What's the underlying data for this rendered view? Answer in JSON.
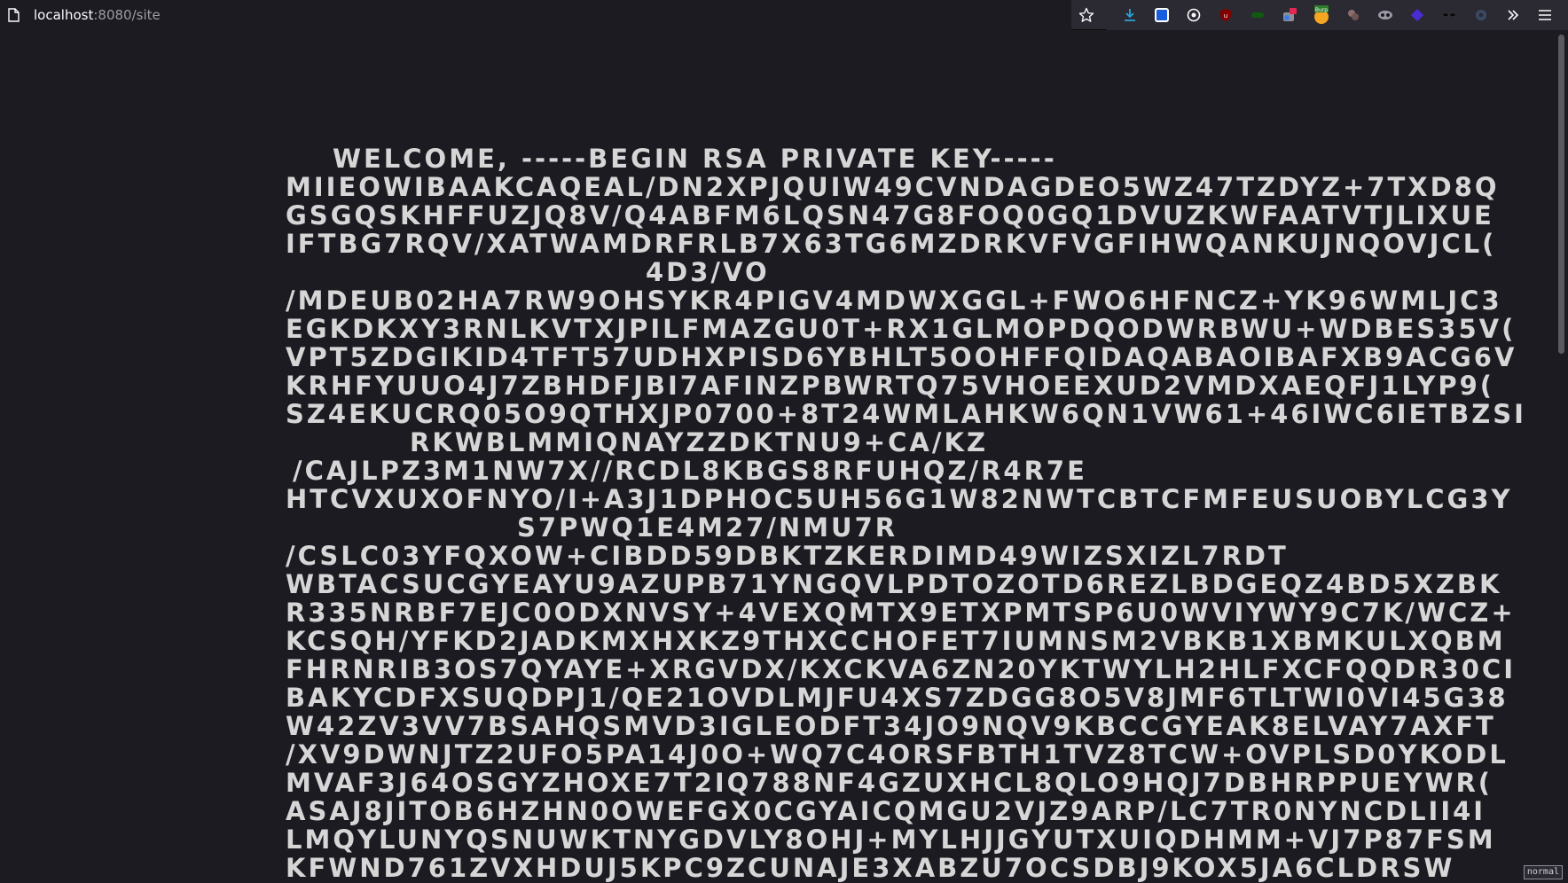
{
  "browser": {
    "url_host": "localhost",
    "url_path": ":8080/site",
    "icons": [
      "page-icon",
      "bookmark-star-icon",
      "download-icon",
      "bitwarden-icon",
      "dark-reader-icon",
      "ublock-icon",
      "green-extension-icon",
      "multi-account-icon",
      "burp-icon",
      "cookie-icon",
      "foxyproxy-icon",
      "purple-extension-icon",
      "mustache-icon",
      "settings-extension-icon",
      "overflow-chevron-icon",
      "menu-icon"
    ],
    "burp_label": "Burp"
  },
  "page": {
    "welcome": "WELCOME, -----BEGIN RSA PRIVATE KEY-----",
    "lines": [
      "MIIEOWIBAAKCAQEAL/DN2XPJQUIW49CVNDAGDEO5WZ47TZDYZ+7TXD8Q",
      "GSGQSKHFFUZJQ8V/Q4ABFM6LQSN47G8FOQ0GQ1DVUZKWFAATVTJLIXUE",
      "IFTBG7RQV/XATWAMDRFRLB7X63TG6MZDRKVFVGFIHWQANKUJNQOVJCL(",
      "4D3/VO",
      "/MDEUB02HA7RW9OHSYKR4PIGV4MDWXGGL+FWO6HFNCZ+YK96WMLJC3",
      "EGKDKXY3RNLKVTXJPILFMAZGU0T+RX1GLMOPDQODWRBWU+WDBES35V(",
      "VPT5ZDGIKID4TFT57UDHXPISD6YBHLT5OOHFFQIDAQABAOIBAFXB9ACG6V",
      "KRHFYUUO4J7ZBHDFJBI7AFINZPBWRTQ75VHOEEXUD2VMDXAEQFJ1LYP9(",
      "SZ4EKUCRQ05O9QTHXJP0700+8T24WMLAHKW6QN1VW61+46IWC6IETBZSI",
      "RKWBLMMIQNAYZZDKTNU9+CA/KZ",
      "/CAJLPZ3M1NW7X//RCDL8KBGS8RFUHQZ/R4R7E",
      "HTCVXUXOFNYO/I+A3J1DPHOC5UH56G1W82NWTCBTCFMFEUSUOBYLCG3Y",
      "S7PWQ1E4M27/NMU7R",
      "/CSLC03YFQXOW+CIBDD59DBKTZKERDIMD49WIZSXIZL7RDT",
      "WBTACSUCGYEAYU9AZUPB71YNGQVLPDTOZOTD6REZLBDGEQZ4BD5XZBK",
      "R335NRBF7EJC0ODXNVSY+4VEXQMTX9ETXPMTSP6U0WVIYWY9C7K/WCZ+",
      "KCSQH/YFKD2JADKMXHXKZ9THXCCHOFET7IUMNSM2VBKB1XBMKULXQBM",
      "FHRNRIB3OS7QYAYE+XRGVDX/KXCKVA6ZN20YKTWYLH2HLFXCFQQDR30CI",
      "BAKYCDFXSUQDPJ1/QE21OVDLMJFU4XS7ZDGG8O5V8JMF6TLTWI0VI45G38",
      "W42ZV3VV7BSAHQSMVD3IGLEODFT34JO9NQV9KBCCGYEAK8ELVAY7AXFT",
      "/XV9DWNJTZ2UFO5PA14J0O+WQ7C4ORSFBTH1TVZ8TCW+OVPLSD0YKODL",
      "MVAF3J64OSGYZHOXE7T2IQ788NF4GZUXHCL8QLO9HQJ7DBHRPPUEYWR(",
      "ASAJ8JITOB6HZHN0OWEFGX0CGYAICQMGU2VJZ9ARP/LC7TR0NYNCDLII4I",
      "LMQYLUNYQSNUWKTNYGDVLY8OHJ+MYLHJJGYUTXUIQDHMM+VJ7P87FSM",
      "KFWND761ZVXHDUJ5KPC9ZCUNAJE3XABZU7OCSDBJ9KOX5JA6CLDRSW"
    ],
    "indents": [
      0,
      0,
      0,
      406,
      0,
      0,
      0,
      0,
      0,
      140,
      8,
      0,
      261,
      0,
      0,
      0,
      0,
      0,
      0,
      0,
      0,
      0,
      0,
      0,
      0
    ],
    "mode_badge": "normal"
  }
}
